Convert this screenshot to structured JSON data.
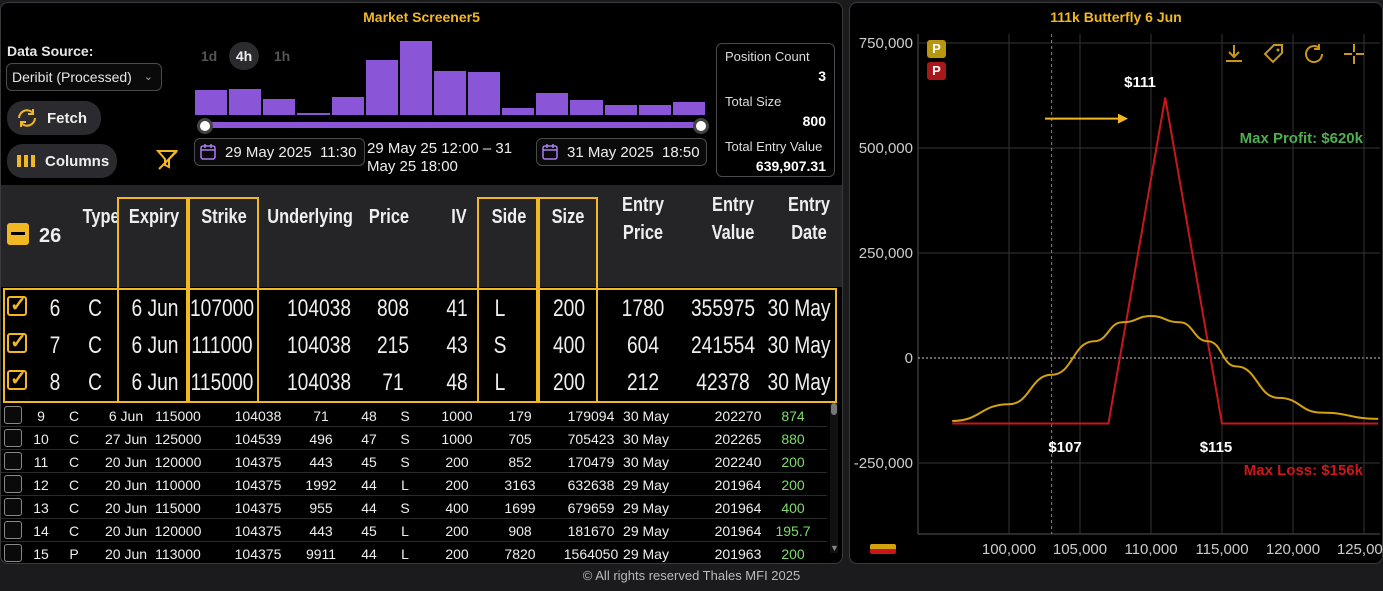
{
  "screener": {
    "title": "Market Screener5",
    "data_source_label": "Data Source:",
    "data_source_value": "Deribit (Processed)",
    "fetch_label": "Fetch",
    "columns_label": "Columns",
    "timeframes": [
      "1d",
      "4h",
      "1h"
    ],
    "active_timeframe": "4h",
    "histogram": [
      0.34,
      0.35,
      0.22,
      0.03,
      0.25,
      0.74,
      1.0,
      0.6,
      0.58,
      0.1,
      0.3,
      0.2,
      0.13,
      0.13,
      0.18
    ],
    "range_start": "29 May 2025  11:30",
    "range_end": "31 May 2025  18:50",
    "range_text_line1": "29 May 25 12:00 – 31",
    "range_text_line2": "May 25 18:00",
    "stats": {
      "position_count_label": "Position Count",
      "position_count": "3",
      "total_size_label": "Total Size",
      "total_size": "800",
      "total_entry_value_label": "Total Entry Value",
      "total_entry_value": "639,907.31"
    },
    "selected_count": "26",
    "columns": [
      "Type",
      "Expiry",
      "Strike",
      "Underlying",
      "Price",
      "IV",
      "Side",
      "Size",
      "Entry Price",
      "Entry Value",
      "Entry Date"
    ],
    "column_lines": [
      [
        "Type"
      ],
      [
        "Expiry"
      ],
      [
        "Strike"
      ],
      [
        "Underlying"
      ],
      [
        "Price"
      ],
      [
        "IV"
      ],
      [
        "Side"
      ],
      [
        "Size"
      ],
      [
        "Entry",
        "Price"
      ],
      [
        "Entry",
        "Value"
      ],
      [
        "Entry",
        "Date"
      ]
    ],
    "selected_rows": [
      [
        "6",
        "C",
        "6 Jun",
        "107000",
        "104038",
        "808",
        "41",
        "L",
        "200",
        "1780",
        "355975",
        "30 May"
      ],
      [
        "7",
        "C",
        "6 Jun",
        "111000",
        "104038",
        "215",
        "43",
        "S",
        "400",
        "604",
        "241554",
        "30 May"
      ],
      [
        "8",
        "C",
        "6 Jun",
        "115000",
        "104038",
        "71",
        "48",
        "L",
        "200",
        "212",
        "42378",
        "30 May"
      ]
    ],
    "rows": [
      [
        "9",
        "C",
        "6 Jun",
        "115000",
        "104038",
        "71",
        "48",
        "S",
        "1000",
        "179",
        "179094",
        "30 May",
        "202270",
        "874"
      ],
      [
        "10",
        "C",
        "27 Jun",
        "125000",
        "104539",
        "496",
        "47",
        "S",
        "1000",
        "705",
        "705423",
        "30 May",
        "202265",
        "880"
      ],
      [
        "11",
        "C",
        "20 Jun",
        "120000",
        "104375",
        "443",
        "45",
        "S",
        "200",
        "852",
        "170479",
        "30 May",
        "202240",
        "200"
      ],
      [
        "12",
        "C",
        "20 Jun",
        "110000",
        "104375",
        "1992",
        "44",
        "L",
        "200",
        "3163",
        "632638",
        "29 May",
        "201964",
        "200"
      ],
      [
        "13",
        "C",
        "20 Jun",
        "115000",
        "104375",
        "955",
        "44",
        "S",
        "400",
        "1699",
        "679659",
        "29 May",
        "201964",
        "400"
      ],
      [
        "14",
        "C",
        "20 Jun",
        "120000",
        "104375",
        "443",
        "45",
        "L",
        "200",
        "908",
        "181670",
        "29 May",
        "201964",
        "195.7"
      ],
      [
        "15",
        "P",
        "20 Jun",
        "113000",
        "104375",
        "9911",
        "44",
        "L",
        "200",
        "7820",
        "1564050",
        "29 May",
        "201963",
        "200"
      ]
    ],
    "footer": "© All rights reserved Thales MFI 2025"
  },
  "chart_data": {
    "type": "line",
    "title": "111k Butterfly 6 Jun",
    "xlim": [
      96000,
      126000
    ],
    "ylim": [
      -320000,
      760000
    ],
    "xticks": [
      "100,000",
      "105,000",
      "110,000",
      "115,000",
      "120,000",
      "125,000"
    ],
    "xtick_values": [
      100000,
      105000,
      110000,
      115000,
      120000,
      125000
    ],
    "yticks": [
      "750,000",
      "500,000",
      "250,000",
      "0",
      "-250,000"
    ],
    "ytick_values": [
      750000,
      500000,
      250000,
      0,
      -250000
    ],
    "series": [
      {
        "color": "#c8171b",
        "x": [
          96000,
          105000,
          107000,
          111000,
          115000,
          117000,
          126000
        ],
        "y": [
          -156000,
          -156000,
          -156000,
          620000,
          -156000,
          -156000,
          -156000
        ]
      },
      {
        "color": "#d4a20e",
        "x": [
          96000,
          100000,
          103000,
          106000,
          108000,
          110000,
          112000,
          114000,
          116000,
          119000,
          122000,
          126000
        ],
        "y": [
          -150000,
          -110000,
          -40000,
          40000,
          85000,
          100000,
          85000,
          40000,
          -20000,
          -95000,
          -130000,
          -145000
        ]
      }
    ],
    "annotations": {
      "peak": "$111",
      "left_strike": "$107",
      "right_strike": "$115",
      "max_profit": "Max Profit: $620k",
      "max_loss": "Max Loss: $156k"
    },
    "colors": {
      "profit": "#4caf50",
      "loss": "#d0161b",
      "accent": "#f2b824"
    },
    "vline_x": 103000
  }
}
